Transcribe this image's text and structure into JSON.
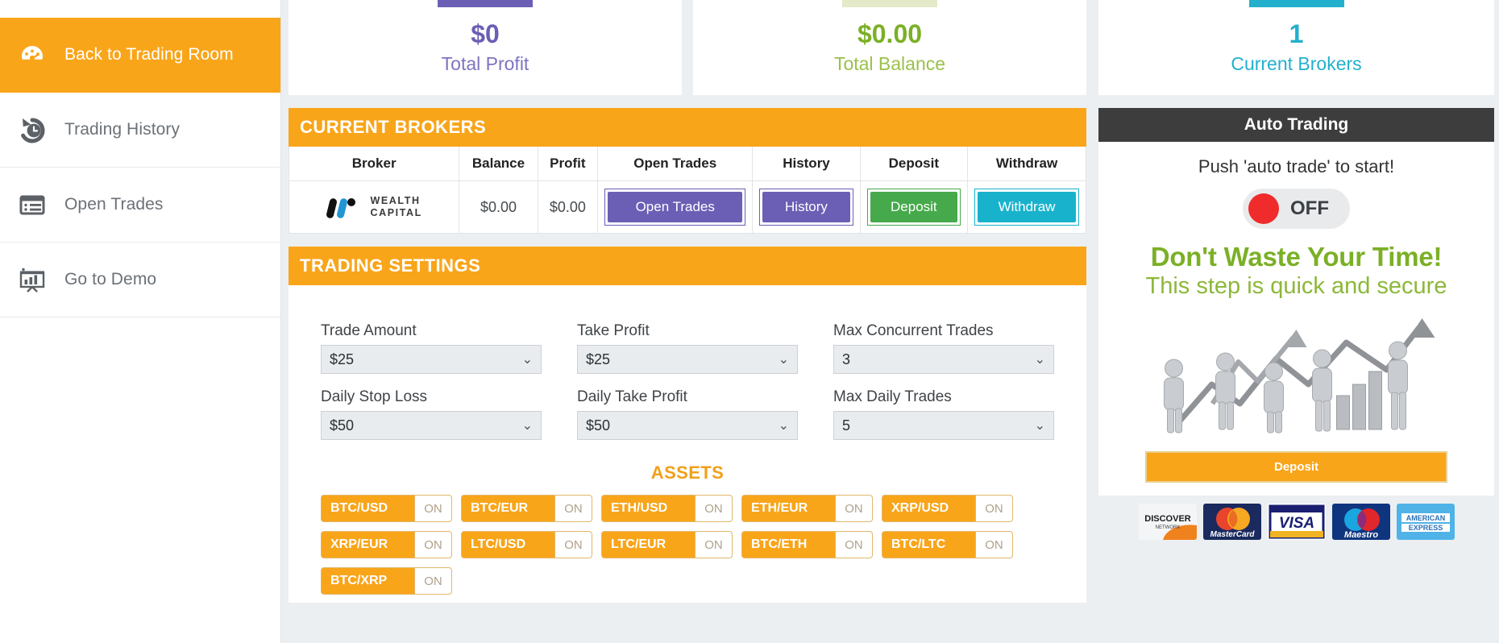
{
  "sidebar": {
    "items": [
      {
        "label": "Back to Trading Room",
        "icon": "dashboard-gauge-icon",
        "active": true
      },
      {
        "label": "Trading History",
        "icon": "history-clock-icon",
        "active": false
      },
      {
        "label": "Open Trades",
        "icon": "list-table-icon",
        "active": false
      },
      {
        "label": "Go to Demo",
        "icon": "presentation-chart-icon",
        "active": false
      }
    ]
  },
  "stats": [
    {
      "value": "$0",
      "label": "Total Profit",
      "color": "#6a5fb5"
    },
    {
      "value": "$0.00",
      "label": "Total Balance",
      "color": "#8cb83a"
    },
    {
      "value": "1",
      "label": "Current Brokers",
      "color": "#22b0cd"
    }
  ],
  "brokers_panel": {
    "title": "CURRENT BROKERS",
    "columns": [
      "Broker",
      "Balance",
      "Profit",
      "Open Trades",
      "History",
      "Deposit",
      "Withdraw"
    ],
    "rows": [
      {
        "broker_name_line1": "WEALTH",
        "broker_name_line2": "CAPITAL",
        "balance": "$0.00",
        "profit": "$0.00",
        "open_trades_label": "Open Trades",
        "history_label": "History",
        "deposit_label": "Deposit",
        "withdraw_label": "Withdraw"
      }
    ]
  },
  "trading_settings": {
    "title": "TRADING SETTINGS",
    "fields": [
      {
        "label": "Trade Amount",
        "value": "$25"
      },
      {
        "label": "Take Profit",
        "value": "$25"
      },
      {
        "label": "Max Concurrent Trades",
        "value": "3"
      },
      {
        "label": "Daily Stop Loss",
        "value": "$50"
      },
      {
        "label": "Daily Take Profit",
        "value": "$50"
      },
      {
        "label": "Max Daily Trades",
        "value": "5"
      }
    ],
    "assets_title": "ASSETS",
    "assets": [
      {
        "pair": "BTC/USD",
        "state": "ON"
      },
      {
        "pair": "BTC/EUR",
        "state": "ON"
      },
      {
        "pair": "ETH/USD",
        "state": "ON"
      },
      {
        "pair": "ETH/EUR",
        "state": "ON"
      },
      {
        "pair": "XRP/USD",
        "state": "ON"
      },
      {
        "pair": "XRP/EUR",
        "state": "ON"
      },
      {
        "pair": "LTC/USD",
        "state": "ON"
      },
      {
        "pair": "LTC/EUR",
        "state": "ON"
      },
      {
        "pair": "BTC/ETH",
        "state": "ON"
      },
      {
        "pair": "BTC/LTC",
        "state": "ON"
      },
      {
        "pair": "BTC/XRP",
        "state": "ON"
      }
    ]
  },
  "auto_trading": {
    "title": "Auto Trading",
    "subtitle": "Push 'auto trade' to start!",
    "toggle_state": "OFF",
    "toggle_color": "#f02b2b",
    "promo_headline": "Don't Waste Your Time!",
    "promo_subline": "This step is quick and secure",
    "deposit_label": "Deposit",
    "payment_cards": [
      {
        "name": "discover-card-logo",
        "text": "DISCOVER",
        "sub": "NETWORK"
      },
      {
        "name": "mastercard-logo",
        "text": "MasterCard",
        "sub": ""
      },
      {
        "name": "visa-logo",
        "text": "VISA",
        "sub": ""
      },
      {
        "name": "maestro-logo",
        "text": "Maestro",
        "sub": ""
      },
      {
        "name": "american-express-logo",
        "text": "AMERICAN",
        "sub": "EXPRESS"
      }
    ]
  }
}
